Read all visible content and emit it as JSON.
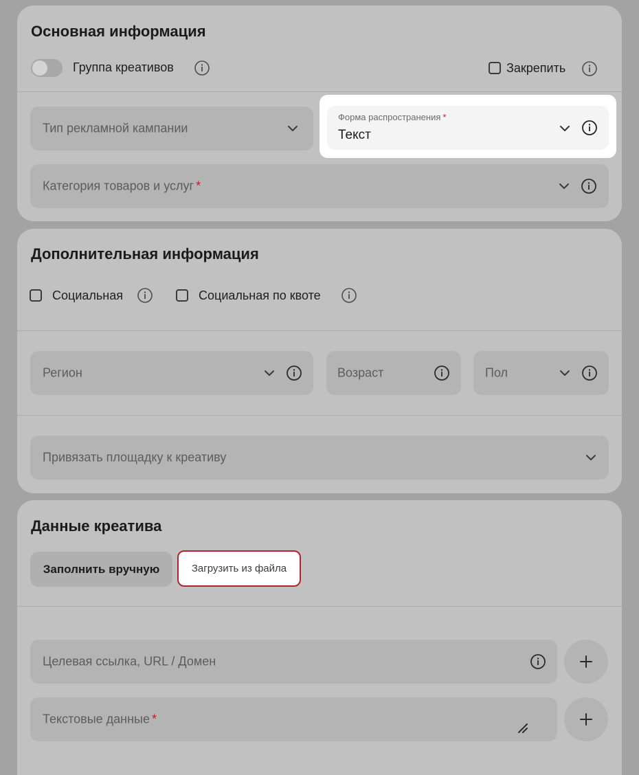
{
  "basic": {
    "title": "Основная информация",
    "group_label": "Группа креативов",
    "pin_label": "Закрепить",
    "campaign_type": "Тип рекламной кампании",
    "distribution_form_label": "Форма распространения",
    "distribution_form_value": "Текст",
    "category": "Категория товаров и услуг",
    "required_mark": "*"
  },
  "additional": {
    "title": "Дополнительная информация",
    "social_label": "Социальная",
    "social_quota_label": "Социальная по квоте",
    "region": "Регион",
    "age": "Возраст",
    "gender": "Пол",
    "platform": "Привязать площадку к креативу"
  },
  "creative": {
    "title": "Данные креатива",
    "manual_button": "Заполнить вручную",
    "file_button": "Загрузить из файла",
    "target_link": "Целевая ссылка, URL / Домен",
    "text_data": "Текстовые данные",
    "required_mark": "*"
  },
  "colors": {
    "accent_red": "#b3222e",
    "card_bg": "#c1c1c1",
    "field_bg": "#b4b4b4"
  },
  "icons": [
    "info-icon",
    "chevron-down-icon",
    "plus-icon",
    "resize-handle-icon",
    "toggle-switch",
    "checkbox"
  ]
}
